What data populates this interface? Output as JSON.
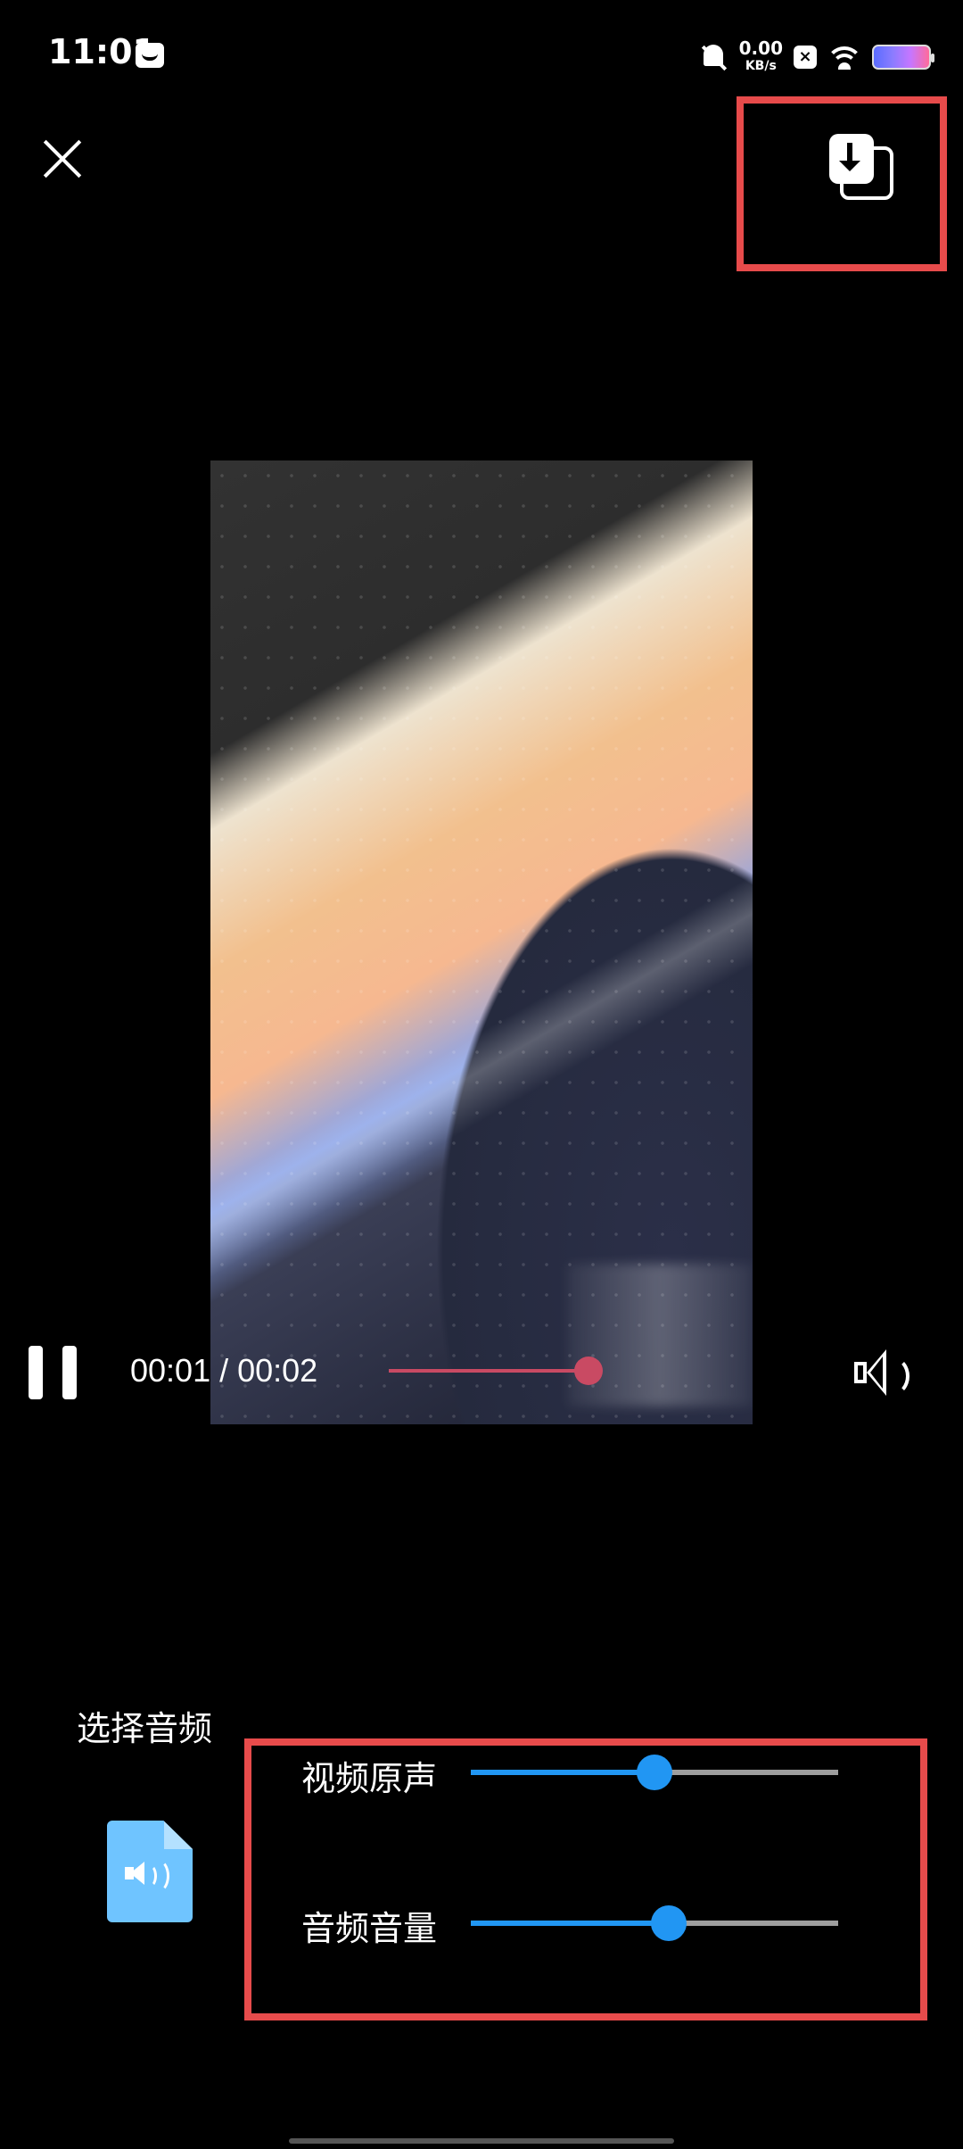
{
  "status_bar": {
    "time": "11:01",
    "net_speed": "0.00",
    "net_unit": "KB/s",
    "icons": [
      "message-icon",
      "bell-muted-icon",
      "x-box-icon",
      "wifi-icon",
      "battery-icon"
    ]
  },
  "toolbar": {
    "close_icon": "close-icon",
    "save_icon": "save-to-gallery-icon"
  },
  "player": {
    "current_time": "00:01",
    "separator": " / ",
    "duration": "00:02",
    "progress_fraction": 1.0,
    "progress_color": "#c94a63",
    "play_state_icon": "pause-icon",
    "volume_icon": "speaker-icon"
  },
  "audio_panel": {
    "title": "选择音频",
    "file_icon": "audio-file-icon",
    "original_label": "视频原声",
    "original_level": 0.5,
    "audio_label": "音频音量",
    "audio_level": 0.54,
    "accent": "#2196f3"
  },
  "highlight_color": "#e74b4b"
}
